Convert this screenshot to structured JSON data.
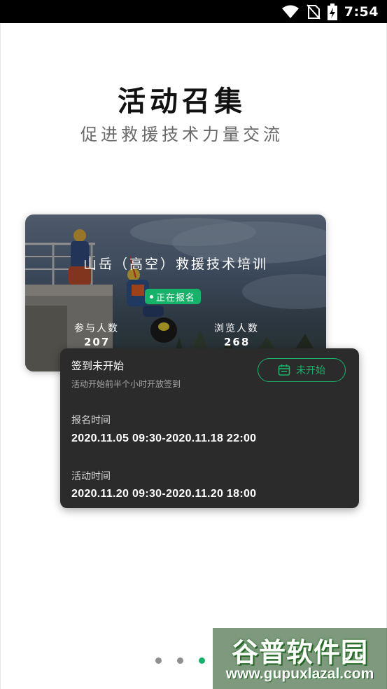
{
  "status_bar": {
    "time": "7:54"
  },
  "hero": {
    "title": "活动召集",
    "subtitle": "促进救援技术力量交流"
  },
  "event_card": {
    "title": "山岳（高空）救援技术培训",
    "status": "正在报名",
    "participants_label": "参与人数",
    "participants_value": "207",
    "views_label": "浏览人数",
    "views_value": "268"
  },
  "info_panel": {
    "signin_title": "签到未开始",
    "signin_note": "活动开始前半个小时开放签到",
    "status_button": "未开始",
    "registration_label": "报名时间",
    "registration_value": "2020.11.05 09:30-2020.11.18 22:00",
    "activity_label": "活动时间",
    "activity_value": "2020.11.20 09:30-2020.11.20 18:00"
  },
  "pager": {
    "count": 3,
    "active_index": 2
  },
  "watermark": {
    "title": "谷普软件园",
    "url": "www.gupuxlazal.com"
  },
  "colors": {
    "accent": "#17b26a",
    "panel": "#2b2b2b",
    "title": "#111111",
    "subtitle": "#6a6a6a"
  }
}
